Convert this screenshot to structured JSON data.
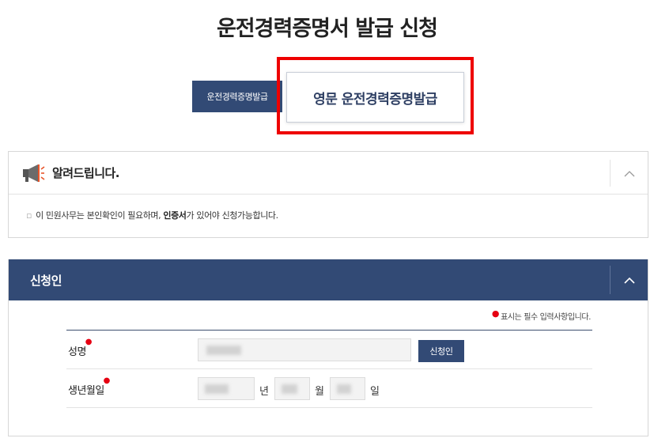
{
  "page": {
    "title": "운전경력증명서 발급 신청"
  },
  "tabs": [
    {
      "label": "운전경력증명발급",
      "active": false
    },
    {
      "label": "영문 운전경력증명발급",
      "active": true
    }
  ],
  "notice": {
    "title": "알려드립니다.",
    "icon": "megaphone-icon",
    "text_before": "이 민원사무는 본인확인이 필요하며, ",
    "text_bold": "인증서",
    "text_after": "가 있어야 신청가능합니다."
  },
  "applicant": {
    "title": "신청인",
    "required_note": "표시는 필수 입력사항입니다.",
    "fields": {
      "name_label": "성명",
      "birth_label": "생년월일",
      "year_unit": "년",
      "month_unit": "월",
      "day_unit": "일",
      "apply_button": "신청인"
    }
  },
  "colors": {
    "navy": "#324a75",
    "required": "#e60012",
    "highlight": "#ee0000"
  }
}
